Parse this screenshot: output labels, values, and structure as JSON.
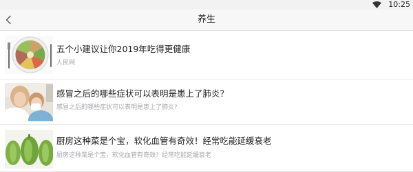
{
  "status_bar": {
    "time": "10:25"
  },
  "header": {
    "title": "养生"
  },
  "articles": [
    {
      "title": "五个小建议让你2019年吃得更健康",
      "subtitle": "人民网",
      "thumbnail": "healthy-meal-plate"
    },
    {
      "title": "感冒之后的哪些症状可以表明是患上了肺炎？",
      "subtitle": "感冒之后的哪些症状可以表明是患上了肺炎?",
      "thumbnail": "sick-child-tissue"
    },
    {
      "title": "厨房这种菜是个宝，软化血管有奇效！经常吃能延缓衰老",
      "subtitle": "厨房这种菜是个宝，软化血管有奇效！经常吃能延缓衰老",
      "thumbnail": "green-bitter-melon"
    }
  ]
}
